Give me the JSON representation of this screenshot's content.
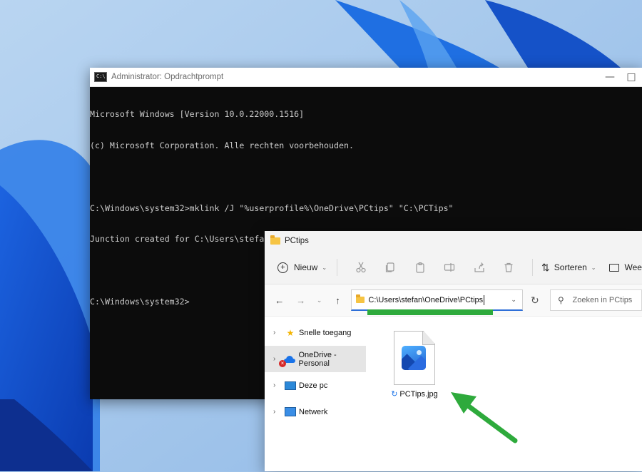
{
  "cmd": {
    "title": "Administrator: Opdrachtprompt",
    "icon_text": "C:\\",
    "lines": [
      "Microsoft Windows [Version 10.0.22000.1516]",
      "(c) Microsoft Corporation. Alle rechten voorbehouden.",
      "",
      "C:\\Windows\\system32>mklink /J \"%userprofile%\\OneDrive\\PCtips\" \"C:\\PCTips\"",
      "Junction created for C:\\Users\\stefan\\OneDrive\\PCtips <<===>> C:\\PCTips",
      "",
      "C:\\Windows\\system32>"
    ]
  },
  "explorer": {
    "title": "PCtips",
    "toolbar": {
      "new_label": "Nieuw",
      "sort_label": "Sorteren",
      "view_label": "Wee"
    },
    "address": "C:\\Users\\stefan\\OneDrive\\PCtips",
    "search_placeholder": "Zoeken in PCtips",
    "sidebar": {
      "items": [
        {
          "label": "Snelle toegang",
          "icon": "star-icon"
        },
        {
          "label": "OneDrive - Personal",
          "icon": "onedrive-icon"
        },
        {
          "label": "Deze pc",
          "icon": "pc-icon"
        },
        {
          "label": "Netwerk",
          "icon": "network-icon"
        }
      ]
    },
    "file": {
      "name": "PCTips.jpg",
      "status_icon": "sync-icon"
    }
  },
  "colors": {
    "annotation_green": "#2eaa3c",
    "accent_blue": "#2e6fd8"
  }
}
